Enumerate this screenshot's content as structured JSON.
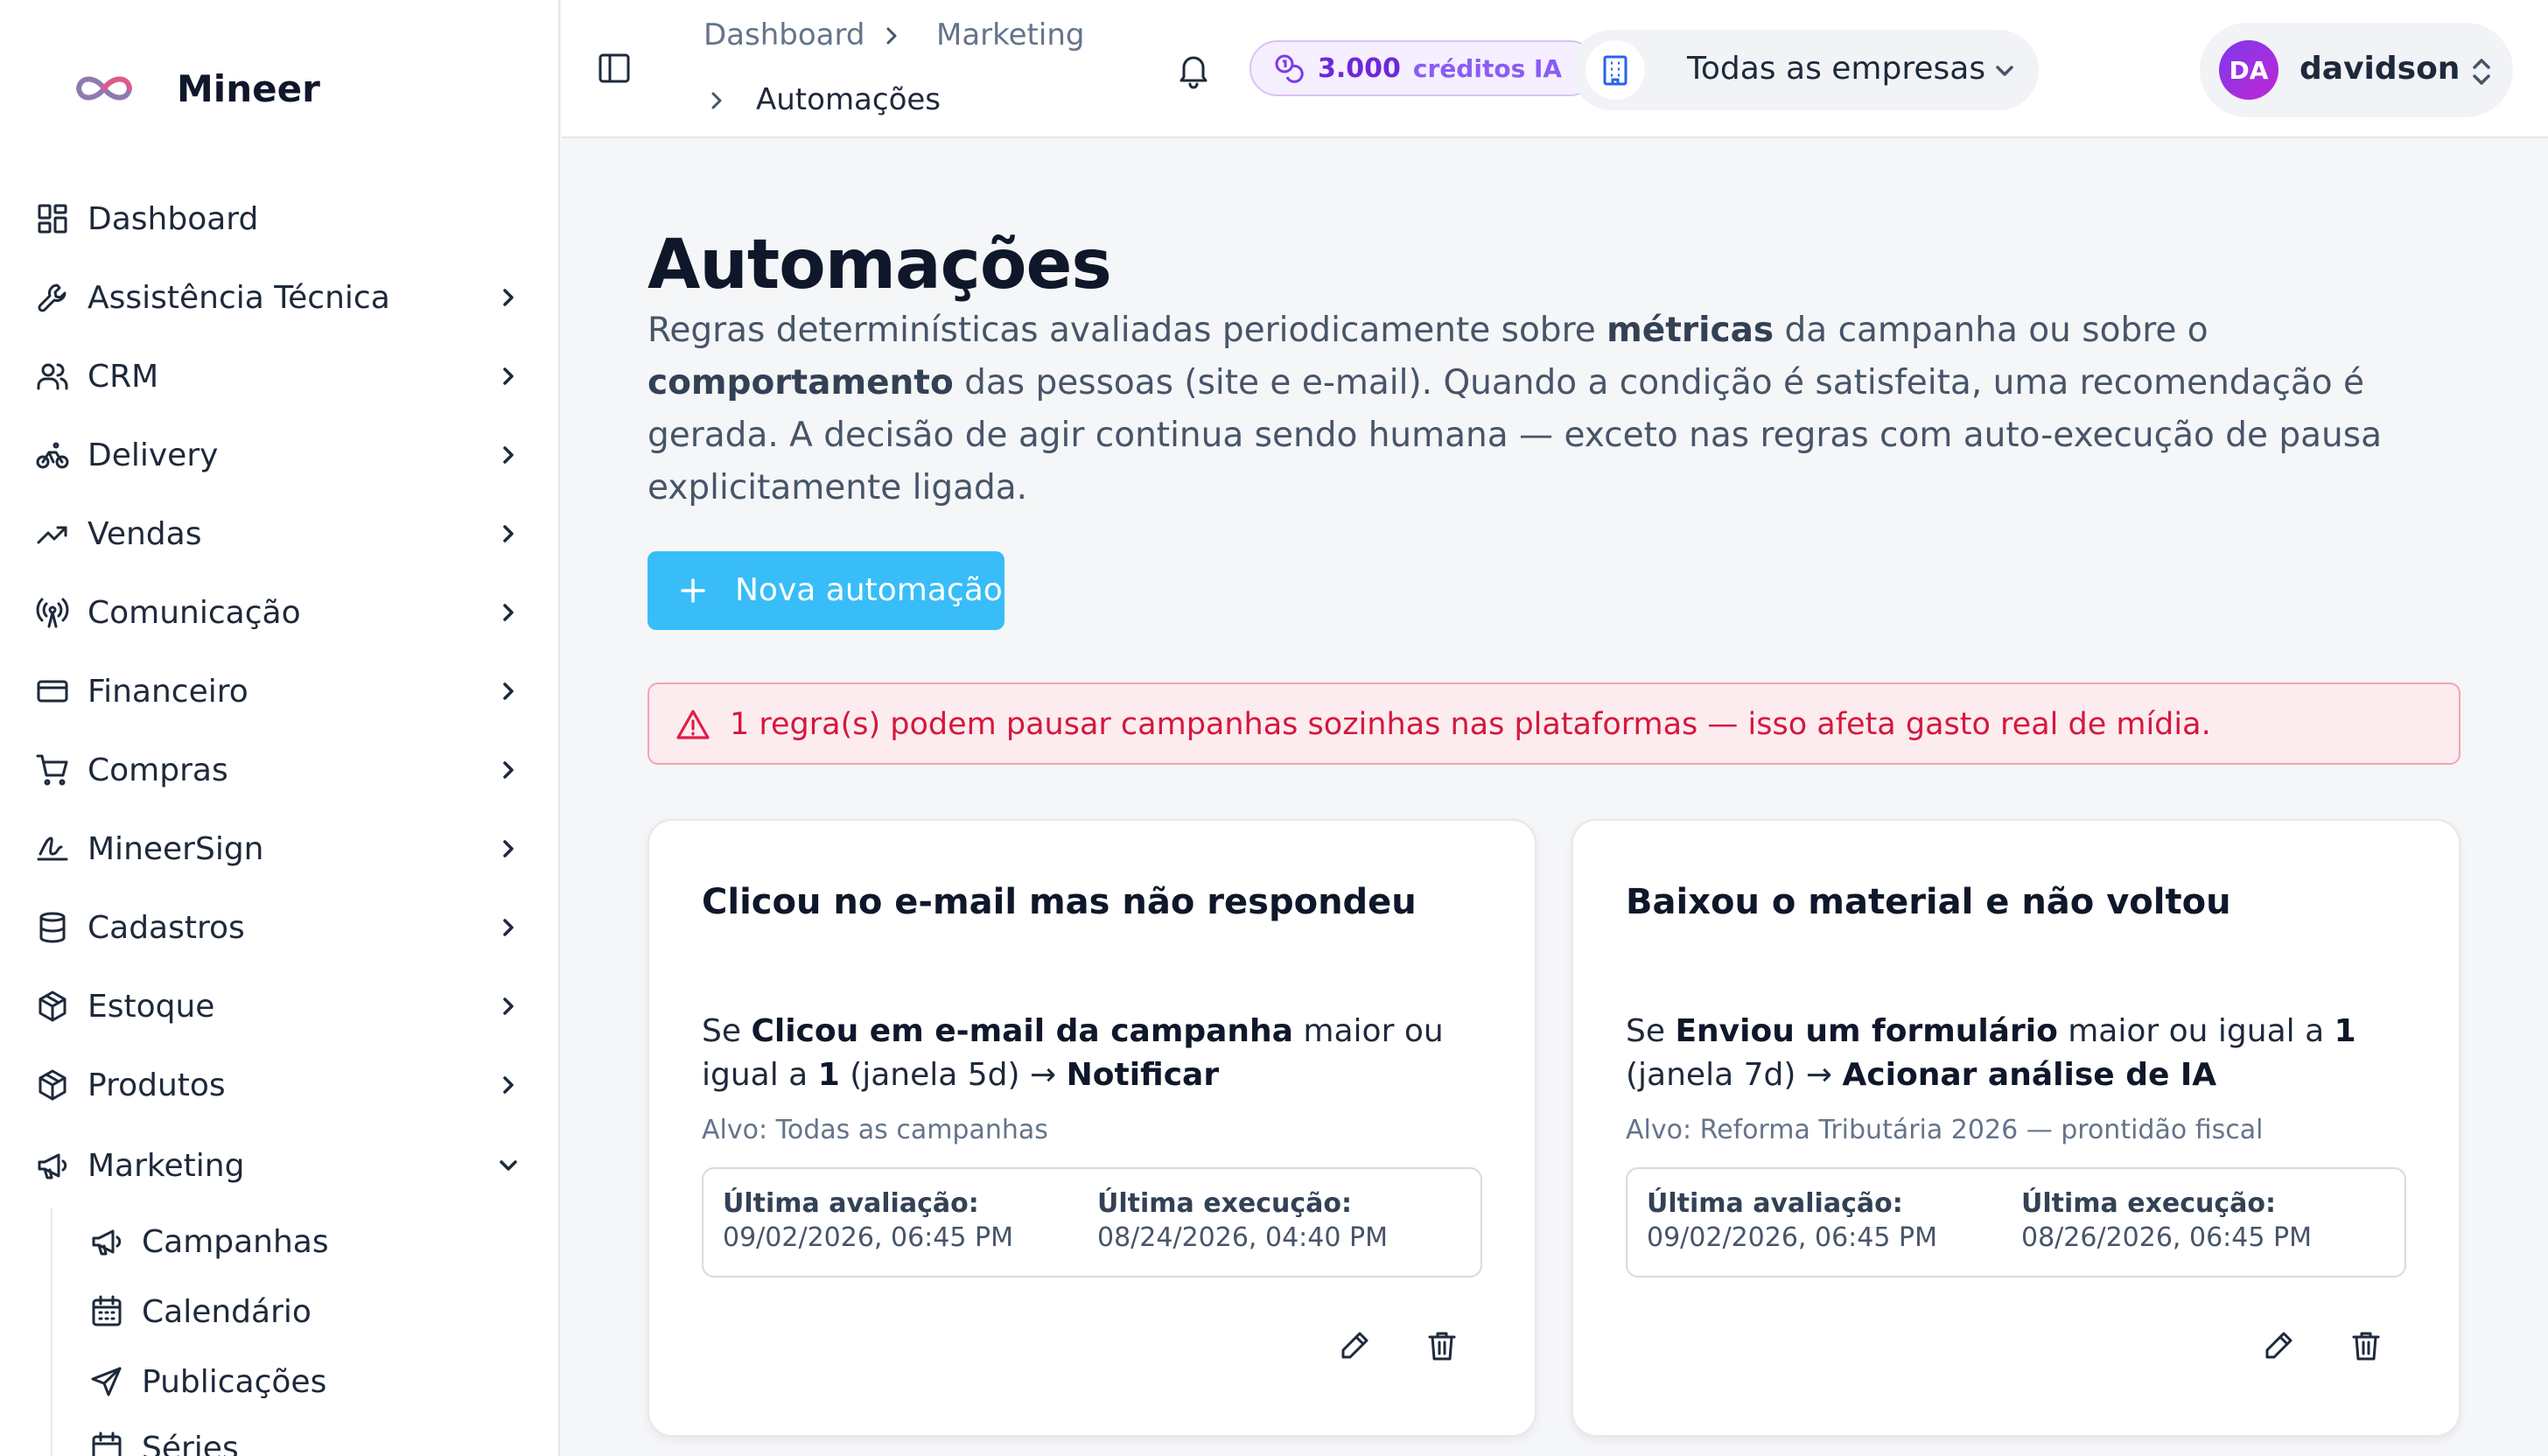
{
  "app": {
    "name": "Mineer"
  },
  "sidebar": {
    "items": [
      {
        "label": "Dashboard",
        "icon": "dashboard-grid-icon",
        "has_children": false
      },
      {
        "label": "Assistência Técnica",
        "icon": "wrench-icon",
        "has_children": true
      },
      {
        "label": "CRM",
        "icon": "users-icon",
        "has_children": true
      },
      {
        "label": "Delivery",
        "icon": "bike-icon",
        "has_children": true
      },
      {
        "label": "Vendas",
        "icon": "trending-up-icon",
        "has_children": true
      },
      {
        "label": "Comunicação",
        "icon": "radio-tower-icon",
        "has_children": true
      },
      {
        "label": "Financeiro",
        "icon": "credit-card-icon",
        "has_children": true
      },
      {
        "label": "Compras",
        "icon": "shopping-cart-icon",
        "has_children": true
      },
      {
        "label": "MineerSign",
        "icon": "signature-icon",
        "has_children": true
      },
      {
        "label": "Cadastros",
        "icon": "database-icon",
        "has_children": true
      },
      {
        "label": "Estoque",
        "icon": "package-icon",
        "has_children": true
      },
      {
        "label": "Produtos",
        "icon": "package-icon",
        "has_children": true
      },
      {
        "label": "Marketing",
        "icon": "megaphone-icon",
        "has_children": true,
        "expanded": true
      }
    ],
    "marketing_children": [
      {
        "label": "Campanhas",
        "icon": "megaphone-icon"
      },
      {
        "label": "Calendário",
        "icon": "calendar-icon"
      },
      {
        "label": "Publicações",
        "icon": "send-icon"
      },
      {
        "label": "Séries",
        "icon": "calendar-clock-icon"
      }
    ]
  },
  "header": {
    "breadcrumb": [
      "Dashboard",
      "Marketing",
      "Automações"
    ],
    "credits": {
      "value": "3.000",
      "label": "créditos IA"
    },
    "company_selector": {
      "value": "Todas as empresas"
    },
    "user": {
      "initials": "DA",
      "name": "davidson"
    }
  },
  "main": {
    "title": "Automações",
    "description": {
      "part1": "Regras determinísticas avaliadas periodicamente sobre ",
      "bold1": "métricas",
      "part2": " da campanha ou sobre o ",
      "bold2": "comportamento",
      "part3": " das pessoas (site e e-mail). Quando a condição é satisfeita, uma recomendação é gerada. A decisão de agir continua sendo humana — exceto nas regras com auto-execução de pausa explicitamente ligada."
    },
    "new_button_label": "Nova automação",
    "alert_text": "1 regra(s) podem pausar campanhas sozinhas nas plataformas — isso afeta gasto real de mídia.",
    "cards": [
      {
        "title": "Clicou no e-mail mas não respondeu",
        "rule_if": "Se ",
        "rule_metric": "Clicou em e-mail da campanha",
        "rule_op": " maior ou igual a ",
        "rule_value": "1",
        "rule_window": " (janela 5d) → ",
        "rule_action": "Notificar",
        "target": "Alvo: Todas as campanhas",
        "last_eval_label": "Última avaliação:",
        "last_eval_value": "09/02/2026, 06:45 PM",
        "last_exec_label": "Última execução:",
        "last_exec_value": "08/24/2026, 04:40 PM"
      },
      {
        "title": "Baixou o material e não voltou",
        "rule_if": "Se ",
        "rule_metric": "Enviou um formulário",
        "rule_op": " maior ou igual a ",
        "rule_value": "1",
        "rule_window": " (janela 7d) → ",
        "rule_action": "Acionar análise de IA",
        "target": "Alvo: Reforma Tributária 2026 — prontidão fiscal",
        "last_eval_label": "Última avaliação:",
        "last_eval_value": "09/02/2026, 06:45 PM",
        "last_exec_label": "Última execução:",
        "last_exec_value": "08/26/2026, 06:45 PM"
      }
    ]
  },
  "colors": {
    "accent": "#38bdf8",
    "alert_bg": "#fdecef",
    "alert_text": "#d4183d",
    "credits_accent": "#7c3aed",
    "avatar": "#9333ea"
  }
}
